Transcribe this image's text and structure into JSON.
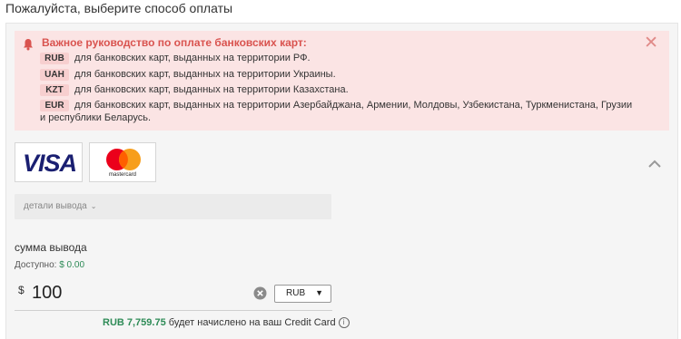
{
  "header": {
    "title": "Пожалуйста, выберите способ оплаты"
  },
  "alert": {
    "title": "Важное руководство по оплате банковских карт:",
    "rows": [
      {
        "code": "RUB",
        "text": "для банковских карт, выданных на территории РФ."
      },
      {
        "code": "UAH",
        "text": "для банковских карт, выданных на территории Украины."
      },
      {
        "code": "KZT",
        "text": "для банковских карт, выданных на территории Казахстана."
      },
      {
        "code": "EUR",
        "text": "для банковских карт, выданных на территории Азербайджана, Армении, Молдовы, Узбекистана, Туркменистана, Грузии и республики Беларусь."
      }
    ],
    "close_glyph": "✕",
    "accent_color": "#d9534f"
  },
  "payment_methods": [
    {
      "name": "VISA"
    },
    {
      "name": "mastercard"
    }
  ],
  "details": {
    "label": "детали вывода",
    "chevron": "⌄"
  },
  "withdraw": {
    "label": "сумма вывода",
    "available_label": "Доступно:",
    "available_value": "$ 0.00",
    "currency_symbol": "$",
    "amount": "100",
    "currency": "RUB",
    "select_arrow": "▼"
  },
  "credit": {
    "amount": "RUB 7,759.75",
    "text": "будет начислено на ваш Credit Card",
    "info_glyph": "i"
  },
  "icons": [
    "bell-icon",
    "close-icon",
    "chevron-up-icon",
    "chevron-down-icon",
    "clear-icon",
    "info-icon"
  ]
}
